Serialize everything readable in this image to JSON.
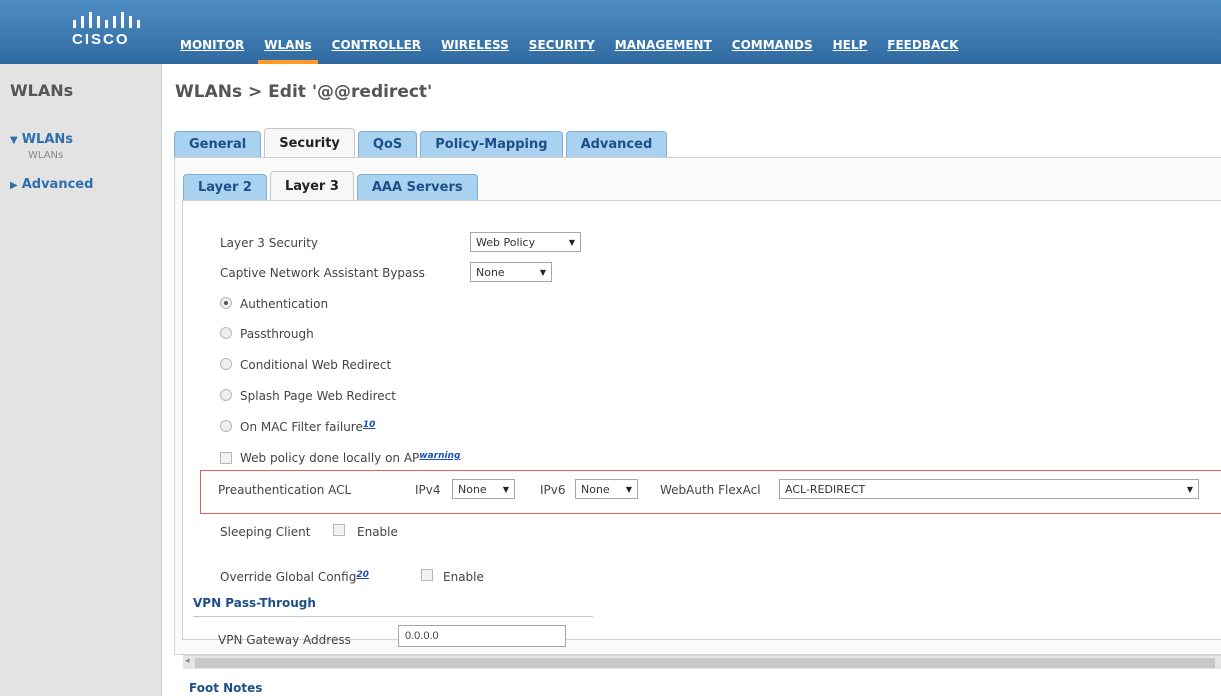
{
  "brand": {
    "logo_text": "CISCO"
  },
  "nav": [
    {
      "label": "MONITOR",
      "active": false
    },
    {
      "label": "WLANs",
      "active": true
    },
    {
      "label": "CONTROLLER",
      "active": false
    },
    {
      "label": "WIRELESS",
      "active": false
    },
    {
      "label": "SECURITY",
      "active": false
    },
    {
      "label": "MANAGEMENT",
      "active": false
    },
    {
      "label": "COMMANDS",
      "active": false
    },
    {
      "label": "HELP",
      "active": false
    },
    {
      "label": "FEEDBACK",
      "active": false
    }
  ],
  "sidebar": {
    "title": "WLANs",
    "items": [
      {
        "label": "WLANs",
        "expanded": true,
        "icon": "caret-down-icon"
      },
      {
        "label": "Advanced",
        "expanded": false,
        "icon": "caret-right-icon"
      }
    ],
    "sub_items": [
      "WLANs"
    ]
  },
  "page": {
    "title": "WLANs > Edit  '@@redirect'"
  },
  "tabs": [
    {
      "label": "General",
      "active": false
    },
    {
      "label": "Security",
      "active": true
    },
    {
      "label": "QoS",
      "active": false
    },
    {
      "label": "Policy-Mapping",
      "active": false
    },
    {
      "label": "Advanced",
      "active": false
    }
  ],
  "subtabs": [
    {
      "label": "Layer 2",
      "active": false
    },
    {
      "label": "Layer 3",
      "active": true
    },
    {
      "label": "AAA Servers",
      "active": false
    }
  ],
  "form": {
    "layer3_security": {
      "label": "Layer 3 Security",
      "value": "Web Policy"
    },
    "cna_bypass": {
      "label": "Captive Network Assistant Bypass",
      "value": "None"
    },
    "radios": [
      {
        "label": "Authentication",
        "checked": true
      },
      {
        "label": "Passthrough",
        "checked": false
      },
      {
        "label": "Conditional Web Redirect",
        "checked": false
      },
      {
        "label": "Splash Page Web Redirect",
        "checked": false
      },
      {
        "label": "On MAC Filter failure",
        "checked": false,
        "footnote": "10"
      }
    ],
    "web_policy_local": {
      "label": "Web policy done locally on AP",
      "link": "warning",
      "checked": false
    },
    "preauth_acl": {
      "label": "Preauthentication ACL",
      "ipv4_label": "IPv4",
      "ipv4_value": "None",
      "ipv6_label": "IPv6",
      "ipv6_value": "None",
      "flex_label": "WebAuth FlexAcl",
      "flex_value": "ACL-REDIRECT"
    },
    "sleeping_client": {
      "label": "Sleeping Client",
      "enable_label": "Enable",
      "checked": false
    },
    "override_global": {
      "label": "Override Global Config",
      "footnote": "20",
      "enable_label": "Enable",
      "checked": false
    },
    "vpn": {
      "heading": "VPN Pass-Through",
      "gateway_label": "VPN Gateway Address",
      "gateway_value": "0.0.0.0"
    }
  },
  "footer": {
    "foot_notes": "Foot Notes"
  },
  "colors": {
    "topbar": "#3b7bb3",
    "active_tab_underline": "#ff9a2a",
    "tab_blue": "#a9d2f0",
    "highlight_border": "#e06060"
  }
}
